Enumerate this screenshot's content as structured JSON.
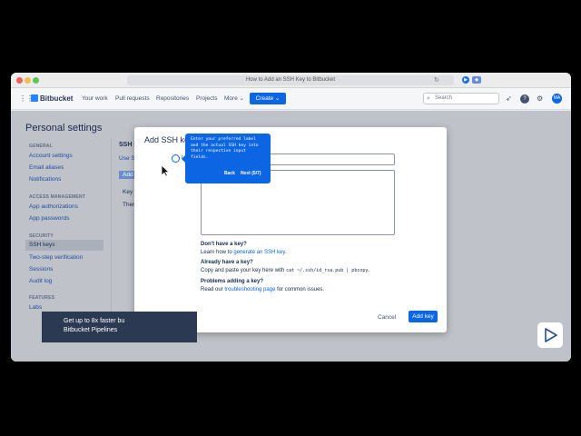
{
  "browser": {
    "tab_title": "How to Add an SSH Key to Bitbucket"
  },
  "topnav": {
    "logo": "Bitbucket",
    "items": [
      "Your work",
      "Pull requests",
      "Repositories",
      "Projects",
      "More ⌄"
    ],
    "create_label": "Create",
    "search_placeholder": "Search",
    "avatar_initials": "MA"
  },
  "page": {
    "title": "Personal settings"
  },
  "sidebar": {
    "sections": [
      {
        "heading": "GENERAL",
        "items": [
          "Account settings",
          "Email aliases",
          "Notifications"
        ]
      },
      {
        "heading": "ACCESS MANAGEMENT",
        "items": [
          "App authorizations",
          "App passwords"
        ]
      },
      {
        "heading": "SECURITY",
        "items": [
          "SSH keys",
          "Two-step verification",
          "Sessions",
          "Audit log"
        ]
      },
      {
        "heading": "FEATURES",
        "items": [
          "Labs"
        ]
      }
    ],
    "active_item": "SSH keys"
  },
  "background": {
    "heading": "SSH k",
    "link": "Use S",
    "button": "Add",
    "col1": "Key",
    "row1": "Ther"
  },
  "modal": {
    "title": "Add SSH key",
    "radio_fragment": "L",
    "help": [
      {
        "heading": "Don't have a key?",
        "text": "Learn how to ",
        "link": "generate an SSH key",
        "text_after": "."
      },
      {
        "heading": "Already have a key?",
        "text": "Copy and paste your key here with ",
        "code": "cat ~/.ssh/id_rsa.pub | pbcopy",
        "text_after": "."
      },
      {
        "heading": "Problems adding a key?",
        "text": "Read our ",
        "link": "troubleshooting page",
        "text_after": " for common issues."
      }
    ],
    "cancel_label": "Cancel",
    "add_label": "Add key"
  },
  "tooltip": {
    "text": "Enter your preferred label and the actual SSH key into their respective input fields.",
    "back_label": "Back",
    "next_label": "Next (5/7)"
  },
  "toast": {
    "line1": "Get up to 8x faster bu",
    "line2": "Bitbucket Pipelines"
  },
  "colors": {
    "primary": "#0c66e4",
    "overlay": "#bfc2c8"
  }
}
